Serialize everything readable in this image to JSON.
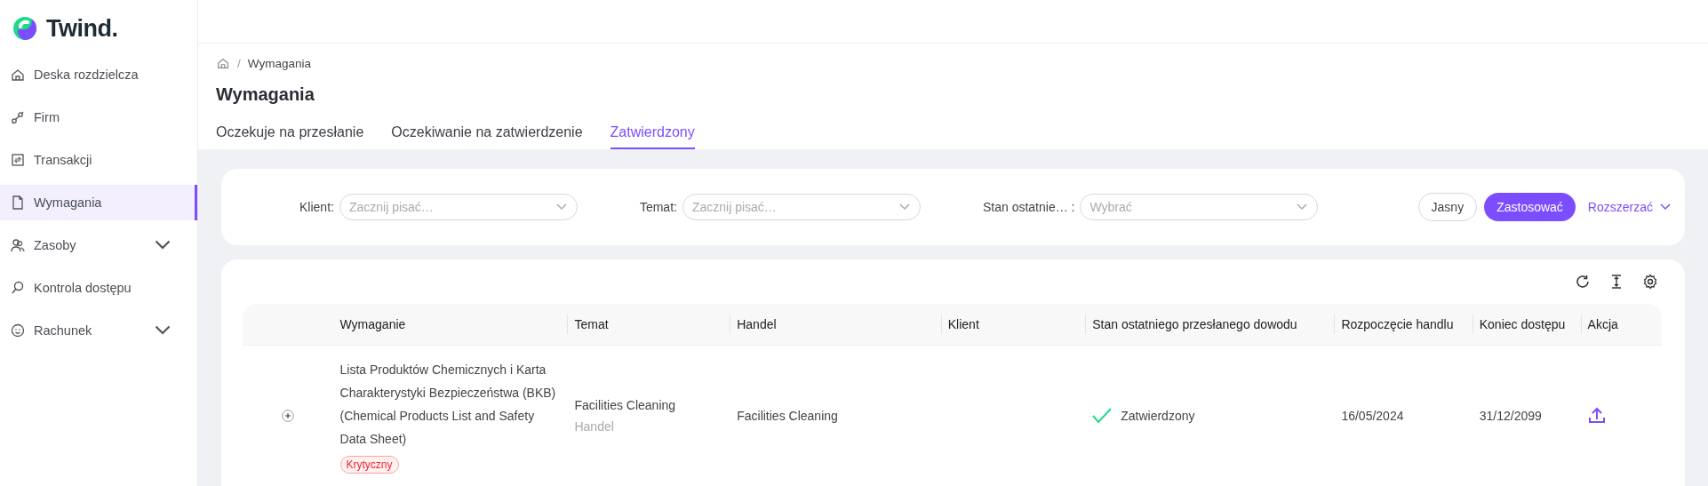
{
  "logo": {
    "text": "Twind."
  },
  "sidebar": {
    "items": [
      {
        "label": "Deska rozdzielcza",
        "selected": false,
        "expandable": false
      },
      {
        "label": "Firm",
        "selected": false,
        "expandable": false
      },
      {
        "label": "Transakcji",
        "selected": false,
        "expandable": false
      },
      {
        "label": "Wymagania",
        "selected": true,
        "expandable": false
      },
      {
        "label": "Zasoby",
        "selected": false,
        "expandable": true
      },
      {
        "label": "Kontrola dostępu",
        "selected": false,
        "expandable": false
      },
      {
        "label": "Rachunek",
        "selected": false,
        "expandable": true
      }
    ]
  },
  "breadcrumb": {
    "separator": "/",
    "current": "Wymagania"
  },
  "title": "Wymagania",
  "tabs": [
    {
      "label": "Oczekuje na przesłanie",
      "selected": false
    },
    {
      "label": "Oczekiwanie na zatwierdzenie",
      "selected": false
    },
    {
      "label": "Zatwierdzony",
      "selected": true
    }
  ],
  "filters": [
    {
      "label": "Klient:",
      "placeholder": "Zacznij pisać…"
    },
    {
      "label": "Temat:",
      "placeholder": "Zacznij pisać…"
    },
    {
      "label": "Stan ostatnie… :",
      "placeholder": "Wybrać"
    }
  ],
  "filter_buttons": {
    "clear": "Jasny",
    "apply": "Zastosować",
    "expand": "Rozszerzać"
  },
  "table": {
    "columns": [
      "Wymaganie",
      "Temat",
      "Handel",
      "Klient",
      "Stan ostatniego przesłanego dowodu",
      "Rozpoczęcie handlu",
      "Koniec dostępu",
      "Akcja"
    ],
    "rows": [
      {
        "expanded": false,
        "requirement": "Lista Produktów Chemicznych i Karta Charakterystyki Bezpieczeństwa (BKB) (Chemical Products List and Safety Data Sheet)",
        "tag": "Krytyczny",
        "topic": "Facilities Cleaning",
        "topic_sub": "Handel",
        "trade": "Facilities Cleaning",
        "status": "Zatwierdzony",
        "start": "16/05/2024",
        "end": "31/12/2099"
      }
    ]
  }
}
